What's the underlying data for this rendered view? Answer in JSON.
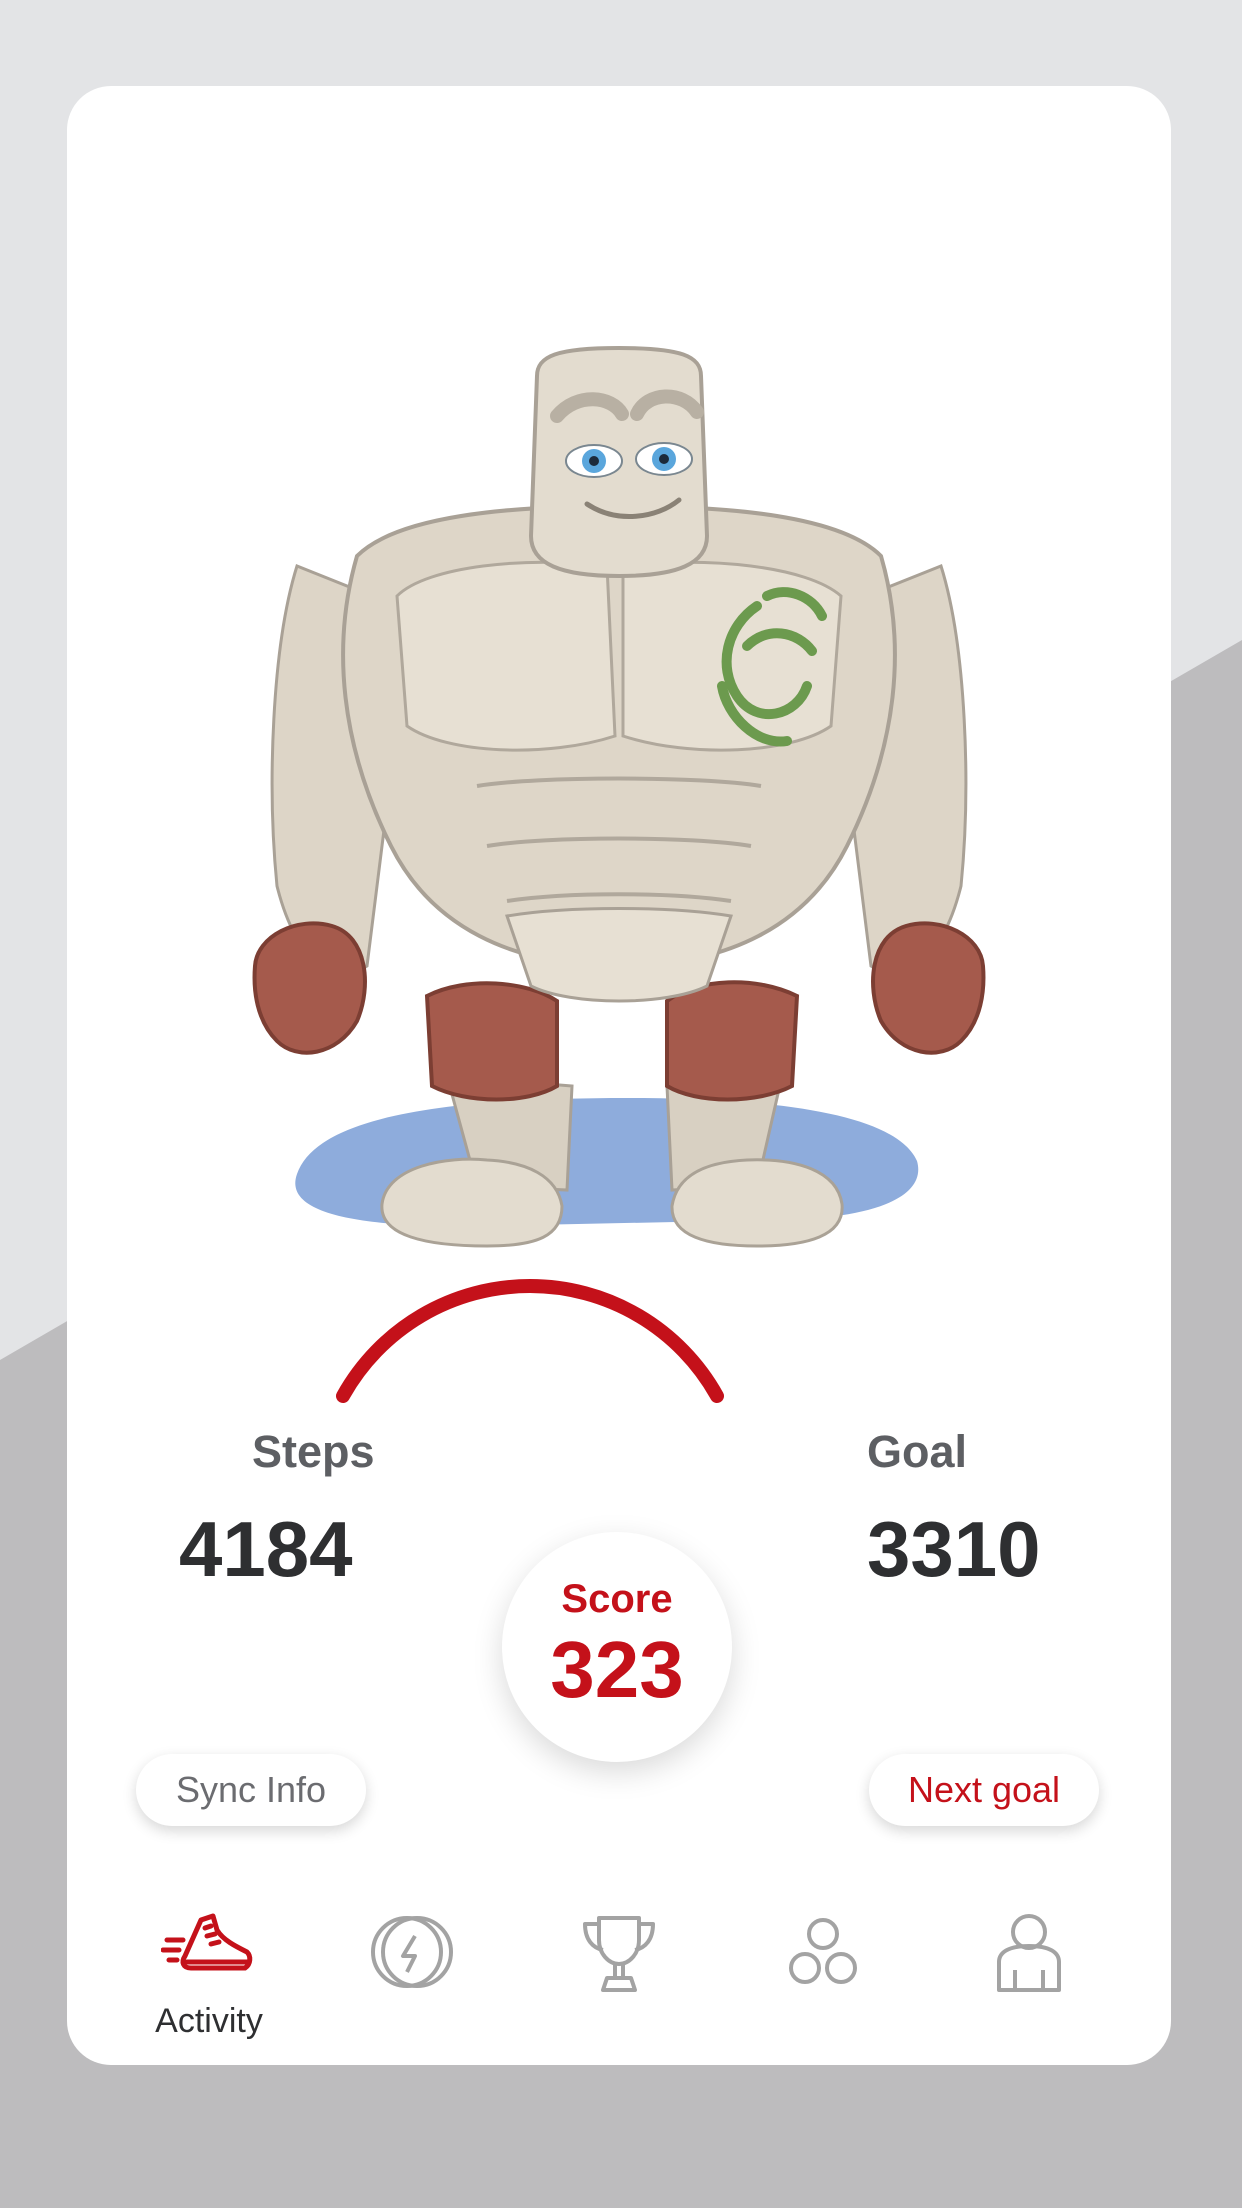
{
  "stats": {
    "steps_label": "Steps",
    "steps_value": "4184",
    "goal_label": "Goal",
    "goal_value": "3310",
    "score_label": "Score",
    "score_value": "323"
  },
  "buttons": {
    "sync_info": "Sync Info",
    "next_goal": "Next goal"
  },
  "nav": {
    "items": [
      {
        "label": "Activity",
        "icon": "running-shoe-icon",
        "active": true
      },
      {
        "label": "",
        "icon": "coin-bolt-icon",
        "active": false
      },
      {
        "label": "",
        "icon": "trophy-icon",
        "active": false
      },
      {
        "label": "",
        "icon": "three-circles-icon",
        "active": false
      },
      {
        "label": "",
        "icon": "person-icon",
        "active": false
      }
    ]
  },
  "colors": {
    "accent": "#c4111a",
    "text_dark": "#2e2f31",
    "text_muted": "#5d5f63",
    "icon_inactive": "#a3a3a3",
    "background_light": "#e3e4e6",
    "background_dark": "#bdbcbe",
    "card": "#ffffff"
  }
}
